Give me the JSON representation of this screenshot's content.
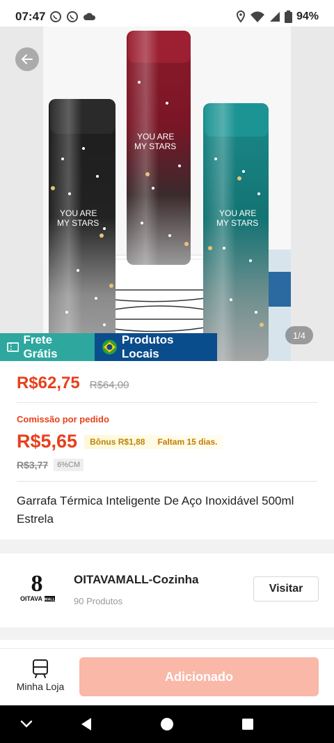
{
  "status_bar": {
    "time": "07:47",
    "battery": "94%",
    "icons": [
      "whatsapp-icon",
      "whatsapp-icon",
      "cloud-icon",
      "location-icon",
      "wifi-icon",
      "signal-icon",
      "battery-icon"
    ]
  },
  "hero": {
    "pager": "1/4",
    "product_text": "YOU ARE MY STARS",
    "badges": {
      "free_shipping": "Frete Grátis",
      "local_products": "Produtos Locais"
    }
  },
  "product": {
    "price": "R$62,75",
    "old_price": "R$64,00",
    "commission_label": "Comissão por pedido",
    "commission_price": "R$5,65",
    "bonus": "Bônus R$1,88",
    "days_left": "Faltam 15 dias.",
    "commission_old": "R$3,77",
    "cm_tag": "6%CM",
    "title": "Garrafa Térmica Inteligente De Aço Inoxidável 500ml Estrela"
  },
  "store": {
    "logo_text": "OITAVA",
    "logo_tag": "MALL",
    "name": "OITAVAMALL-Cozinha",
    "products": "90 Produtos",
    "visit_label": "Visitar"
  },
  "bottom_bar": {
    "store_tab_label": "Minha Loja",
    "add_label": "Adicionado"
  },
  "colors": {
    "accent": "#e8401c",
    "teal_badge": "#2ea89e",
    "blue_badge": "#0a4d8c",
    "add_button": "#f9b8a8"
  }
}
